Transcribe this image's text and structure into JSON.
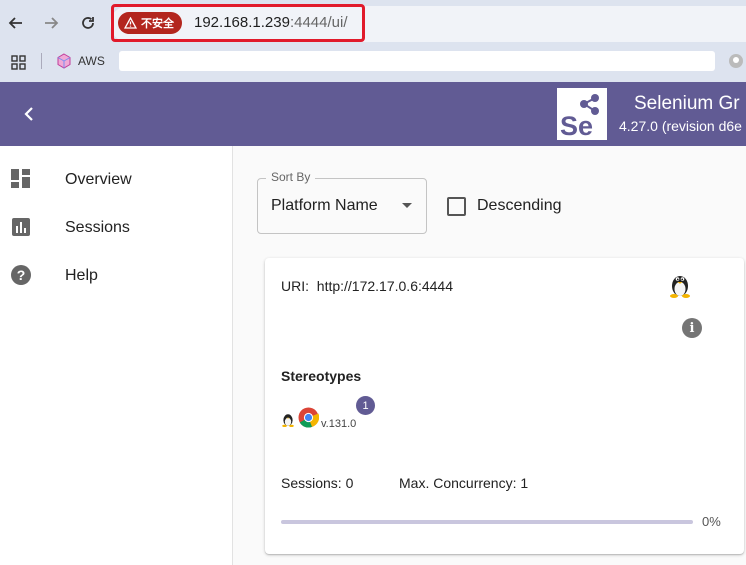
{
  "browser": {
    "security_label": "不安全",
    "url_host": "192.168.1.239",
    "url_rest": ":4444/ui/",
    "bookmark_aws": "AWS"
  },
  "app": {
    "logo_text": "Se",
    "title": "Selenium Gr",
    "version": "4.27.0 (revision d6e",
    "accent_color": "#615b94"
  },
  "sidebar": {
    "items": [
      {
        "label": "Overview",
        "icon": "dashboard-icon"
      },
      {
        "label": "Sessions",
        "icon": "bar-chart-icon"
      },
      {
        "label": "Help",
        "icon": "help-icon"
      }
    ]
  },
  "controls": {
    "sort_label": "Sort By",
    "sort_value": "Platform Name",
    "descending_label": "Descending",
    "descending_checked": false
  },
  "node": {
    "uri_label": "URI:",
    "uri": "http://172.17.0.6:4444",
    "os_icon": "linux-tux-icon",
    "stereotypes_heading": "Stereotypes",
    "stereotype": {
      "os_icon": "linux-tux-icon",
      "browser_icon": "chrome-icon",
      "count": "1",
      "version": "v.131.0"
    },
    "sessions": "Sessions: 0",
    "max_concurrency": "Max. Concurrency: 1",
    "load_fraction": 0,
    "load_label": "0%"
  }
}
